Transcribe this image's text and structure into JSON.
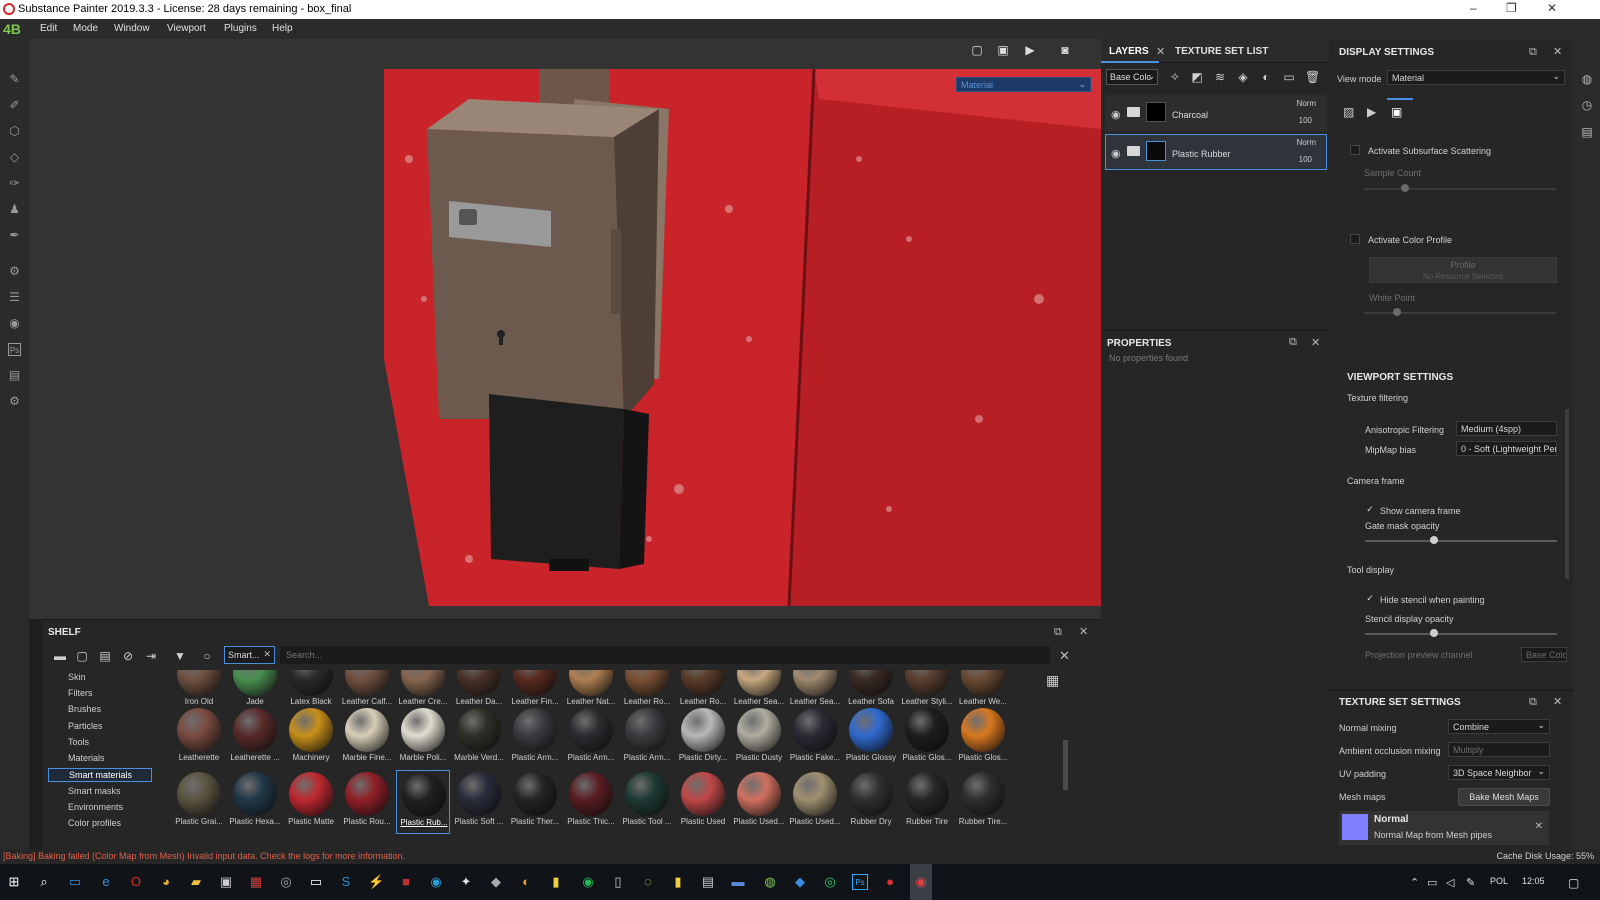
{
  "window": {
    "title": "Substance Painter 2019.3.3 - License: 28 days remaining - box_final",
    "minimize": "–",
    "maximize": "❐",
    "close": "✕"
  },
  "menu": {
    "logo": "4B",
    "items": [
      "Edit",
      "Mode",
      "Window",
      "Viewport",
      "Plugins",
      "Help"
    ]
  },
  "viewport": {
    "material_mode": "Material",
    "accent": "#d0252b"
  },
  "layers_panel": {
    "tabs": [
      "LAYERS",
      "TEXTURE SET LIST"
    ],
    "channel": "Base Colc",
    "layers": [
      {
        "name": "Charcoal",
        "blend": "Norm",
        "opacity": "100"
      },
      {
        "name": "Plastic Rubber",
        "blend": "Norm",
        "opacity": "100"
      }
    ]
  },
  "properties": {
    "title": "PROPERTIES",
    "empty_text": "No properties found"
  },
  "display_settings": {
    "title": "DISPLAY SETTINGS",
    "view_mode_label": "View mode",
    "view_mode_value": "Material",
    "subsurface_label": "Activate Subsurface Scattering",
    "sample_count_label": "Sample Count",
    "color_profile_label": "Activate Color Profile",
    "profile_label": "Profile",
    "profile_value": "No Resource Selected",
    "white_point_label": "White Point",
    "viewport_settings": "VIEWPORT SETTINGS",
    "texture_filtering": "Texture filtering",
    "anisotropic_label": "Anisotropic Filtering",
    "anisotropic_value": "Medium (4spp)",
    "mipmap_label": "MipMap bias",
    "mipmap_value": "0 - Soft (Lightweight Per",
    "camera_frame": "Camera frame",
    "show_camera_frame": "Show camera frame",
    "gate_mask_opacity": "Gate mask opacity",
    "tool_display": "Tool display",
    "hide_stencil": "Hide stencil when painting",
    "stencil_opacity": "Stencil display opacity",
    "projection_preview": "Projection preview channel",
    "projection_value": "Base Color"
  },
  "texture_set_settings": {
    "title": "TEXTURE SET SETTINGS",
    "normal_mixing_label": "Normal mixing",
    "normal_mixing_value": "Combine",
    "ao_mixing_label": "Ambient occlusion mixing",
    "ao_mixing_value": "Multiply",
    "uv_padding_label": "UV padding",
    "uv_padding_value": "3D Space Neighbor",
    "mesh_maps_label": "Mesh maps",
    "bake_button": "Bake Mesh Maps",
    "normal_title": "Normal",
    "normal_sub": "Normal Map from Mesh pipes"
  },
  "shelf": {
    "title": "SHELF",
    "tag": "Smart...",
    "search_placeholder": "Search...",
    "categories": [
      "Skin",
      "Filters",
      "Brushes",
      "Particles",
      "Tools",
      "Materials",
      "Smart materials",
      "Smart masks",
      "Environments",
      "Color profiles"
    ],
    "selected_category": "Smart materials",
    "row1": [
      "Iron Old",
      "Jade",
      "Latex Black",
      "Leather Calf...",
      "Leather Cre...",
      "Leather Da...",
      "Leather Fin...",
      "Leather Nat...",
      "Leather Ro...",
      "Leather Ro...",
      "Leather Sea...",
      "Leather Sea...",
      "Leather Sofa",
      "Leather Styli...",
      "Leather We..."
    ],
    "row2": [
      "Leatherette",
      "Leatherette ...",
      "Machinery",
      "Marble Fine...",
      "Marble Poli...",
      "Marble Verd...",
      "Plastic Arm...",
      "Plastic Arm...",
      "Plastic Arm...",
      "Plastic Dirty...",
      "Plastic Dusty",
      "Plastic Fake...",
      "Plastic Glossy",
      "Plastic Glos...",
      "Plastic Glos..."
    ],
    "row3": [
      "Plastic Grai...",
      "Plastic Hexa...",
      "Plastic Matte",
      "Plastic Rou...",
      "Plastic Rub...",
      "Plastic Soft ...",
      "Plastic Ther...",
      "Plastic Thic...",
      "Plastic Tool ...",
      "Plastic Used",
      "Plastic Used...",
      "Plastic Used...",
      "Rubber Dry",
      "Rubber Tire",
      "Rubber Tire..."
    ],
    "row2_colors": [
      "#7a4a40",
      "#5a2a2a",
      "#c8901a",
      "#d8cfb8",
      "#e0dccf",
      "#2e3026",
      "#3a3a40",
      "#2c2c30",
      "#3c3c40",
      "#b8b8b8",
      "#b0ada0",
      "#2a2a34",
      "#2f6ad0",
      "#1d1d1d",
      "#d87820"
    ],
    "row3_colors": [
      "#5a5440",
      "#213848",
      "#c02830",
      "#902028",
      "#202020",
      "#2a2c3a",
      "#242424",
      "#5a1e22",
      "#1e3a34",
      "#c04848",
      "#d07060",
      "#a09070",
      "#303030",
      "#262626",
      "#2e2e2e"
    ],
    "row1_colors": [
      "#6e5040",
      "#4a9050",
      "#2a2a2a",
      "#705040",
      "#886650",
      "#4a3228",
      "#5a2a20",
      "#b08050",
      "#7a5034",
      "#5a3c2a",
      "#c8a880",
      "#a08a70",
      "#3a2a24",
      "#5a3e30",
      "#6a4a34"
    ]
  },
  "status": {
    "error": "[Baking] Baking failed (Color Map from Mesh) Invalid input data. Check the logs for more information.",
    "cache": "Cache Disk Usage:  55%"
  },
  "taskbar": {
    "lang": "POL",
    "time": "12:05"
  }
}
